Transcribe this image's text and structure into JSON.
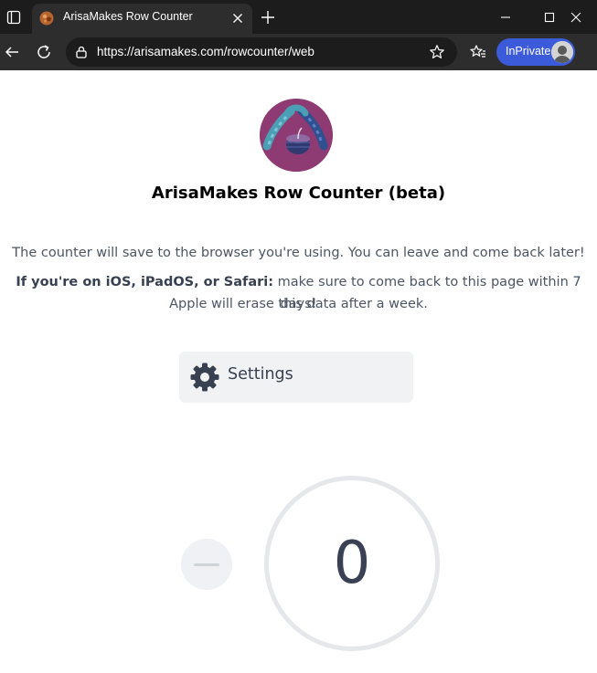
{
  "browser": {
    "tab_title": "ArisaMakes Row Counter",
    "url": "https://arisamakes.com/rowcounter/web",
    "profile_label": "InPrivate",
    "icons": {
      "tab_actions": "tab-actions-icon",
      "close_tab": "close-icon",
      "new_tab": "plus-icon",
      "back": "back-arrow-icon",
      "refresh": "refresh-icon",
      "lock": "lock-icon",
      "favorite": "star-icon",
      "favorites_list": "favorites-icon",
      "minimize": "minimize-icon",
      "maximize": "maximize-icon",
      "close_window": "close-icon"
    },
    "colors": {
      "chrome_dark": "#1c1c1c",
      "chrome": "#2d2d2d",
      "inprivate": "#3b5bdb"
    }
  },
  "page": {
    "logo_icon": "yarn-logo-icon",
    "title": "ArisaMakes Row Counter (beta)",
    "save_notice": "The counter will save to the browser you're using. You can leave and come back later!",
    "ios_notice_bold": "If you're on iOS, iPadOS, or Safari:",
    "ios_notice_rest": " make sure to come back to this page within 7 days!",
    "ios_notice_line2": "Apple will erase this data after a week.",
    "settings_label": "Settings",
    "settings_icon": "gear-icon",
    "decrement_icon": "minus-icon",
    "count": "0",
    "colors": {
      "logo_bg": "#8e3b74",
      "text": "#4b5563",
      "counter_ring": "#e5e7eb"
    }
  }
}
